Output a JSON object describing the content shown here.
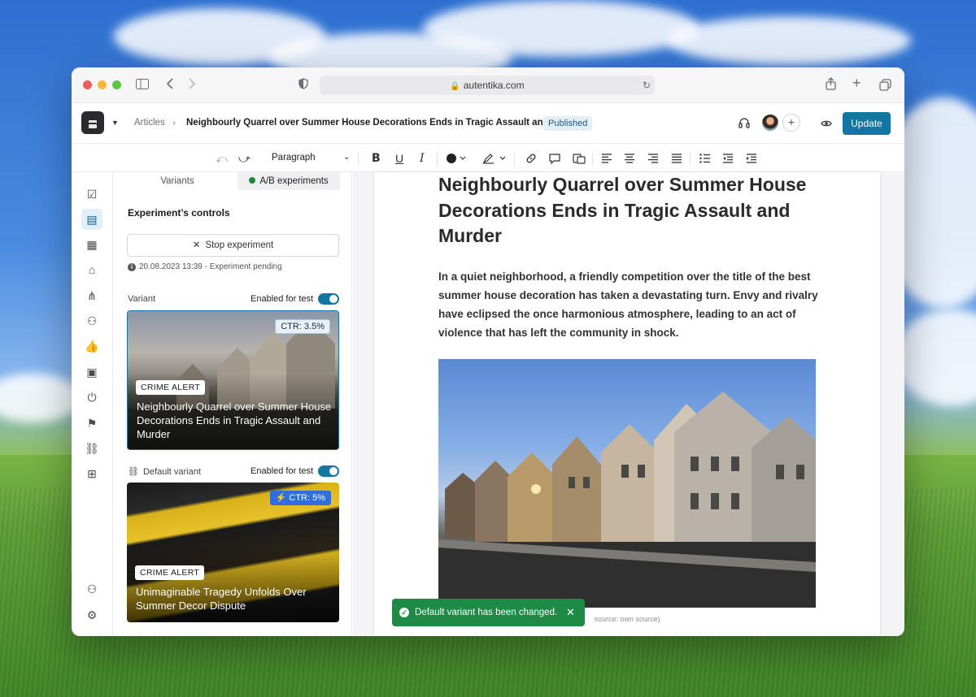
{
  "browser": {
    "url": "autentika.com"
  },
  "header": {
    "breadcrumb_root": "Articles",
    "breadcrumb_sep": "›",
    "article_title": "Neighbourly Quarrel over Summer House Decorations Ends in Tragic Assault and Murder",
    "status_badge": "Published",
    "update_label": "Update"
  },
  "toolbar": {
    "block_type": "Paragraph"
  },
  "panel": {
    "tabs": [
      {
        "label": "Variants"
      },
      {
        "label": "A/B experiments"
      }
    ],
    "section_title": "Experiment’s controls",
    "stop_label": "Stop experiment",
    "info_text": "20.08.2023 13:39 - Experiment pending",
    "variant": {
      "label": "Variant",
      "toggle_label": "Enabled for test",
      "ctr": "CTR: 3.5%",
      "tag": "CRIME ALERT",
      "title": "Neighbourly Quarrel over Summer House Decorations Ends in Tragic Assault and Murder"
    },
    "default_variant": {
      "label": "Default variant",
      "toggle_label": "Enabled for test",
      "ctr": "CTR: 5%",
      "tag": "CRIME ALERT",
      "title": "Unimaginable Tragedy Unfolds Over Summer Decor Dispute"
    }
  },
  "article": {
    "title": "Neighbourly Quarrel over Summer House Decorations Ends in Tragic Assault and Murder",
    "lede": "In a quiet neighborhood, a friendly competition over the title of the best summer house decoration has taken a devastating turn. Envy and rivalry have eclipsed the once harmonious atmosphere, leading to an act of violence that has left the community in shock.",
    "caption": "source: own source)"
  },
  "toast": {
    "message": "Default variant has been changed."
  },
  "colors": {
    "accent": "#1276a1",
    "success": "#1e8a46",
    "ctr_highlight": "#2f6fdc"
  }
}
